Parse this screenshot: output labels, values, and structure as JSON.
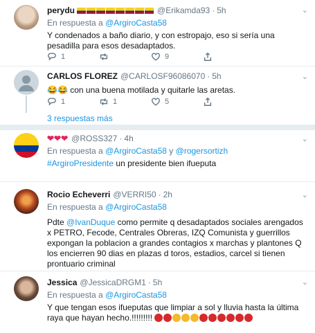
{
  "tweets": [
    {
      "name": "perydu",
      "handle": "@Erikamda93",
      "time": "5h",
      "reply_prefix": "En respuesta a",
      "reply_to": "@ArgiroCasta58",
      "text": "Y condenados a baño diario, y con estropajo, eso si sería una pesadilla para esos desadaptados.",
      "replies": "1",
      "retweets": "",
      "likes": "9"
    },
    {
      "name": "CARLOS FLOREZ",
      "handle": "@CARLOSF96086070",
      "time": "5h",
      "text_emoji": "😂😂",
      "text": "con una buena motilada y quitarle las aretas.",
      "replies": "1",
      "retweets": "1",
      "likes": "5"
    },
    {
      "more_replies": "3 respuestas más"
    },
    {
      "name_hearts": "❤❤❤",
      "handle": "@ROSS327",
      "time": "4h",
      "reply_prefix": "En respuesta a",
      "reply_to": "@ArgiroCasta58",
      "reply_and": "y",
      "reply_to2": "@rogersortizh",
      "hashtag": "#ArgiroPresidente",
      "text": "un presidente bien ifueputa"
    },
    {
      "name": "Rocio Echeverri",
      "handle": "@VERRI50",
      "time": "2h",
      "reply_prefix": "En respuesta a",
      "reply_to": "@ArgiroCasta58",
      "text_pre": "Pdte",
      "mention": "@IvanDuque",
      "text": "como permite q desadaptados sociales arengados x PETRO,  Fecode, Centrales Obreras, IZQ Comunista y guerrillos expongan la poblacion a grandes contagios x marchas y plantones Q los encierren 90 dias en plazas d toros, estadios, carcel si tienen prontuario criminal"
    },
    {
      "name": "Jessica",
      "handle": "@JessicaDRGM1",
      "time": "5h",
      "reply_prefix": "En respuesta a",
      "reply_to": "@ArgiroCasta58",
      "text": "Y que tengan esos ifueputas que limpiar a sol y lluvia hasta la última raya que hayan hecho.!!!!!!!!!"
    }
  ],
  "dot": "·",
  "chevron": "⌄",
  "colors": {
    "link": "#1b95e0",
    "secondary": "#657786",
    "heart": "#e0245e"
  }
}
